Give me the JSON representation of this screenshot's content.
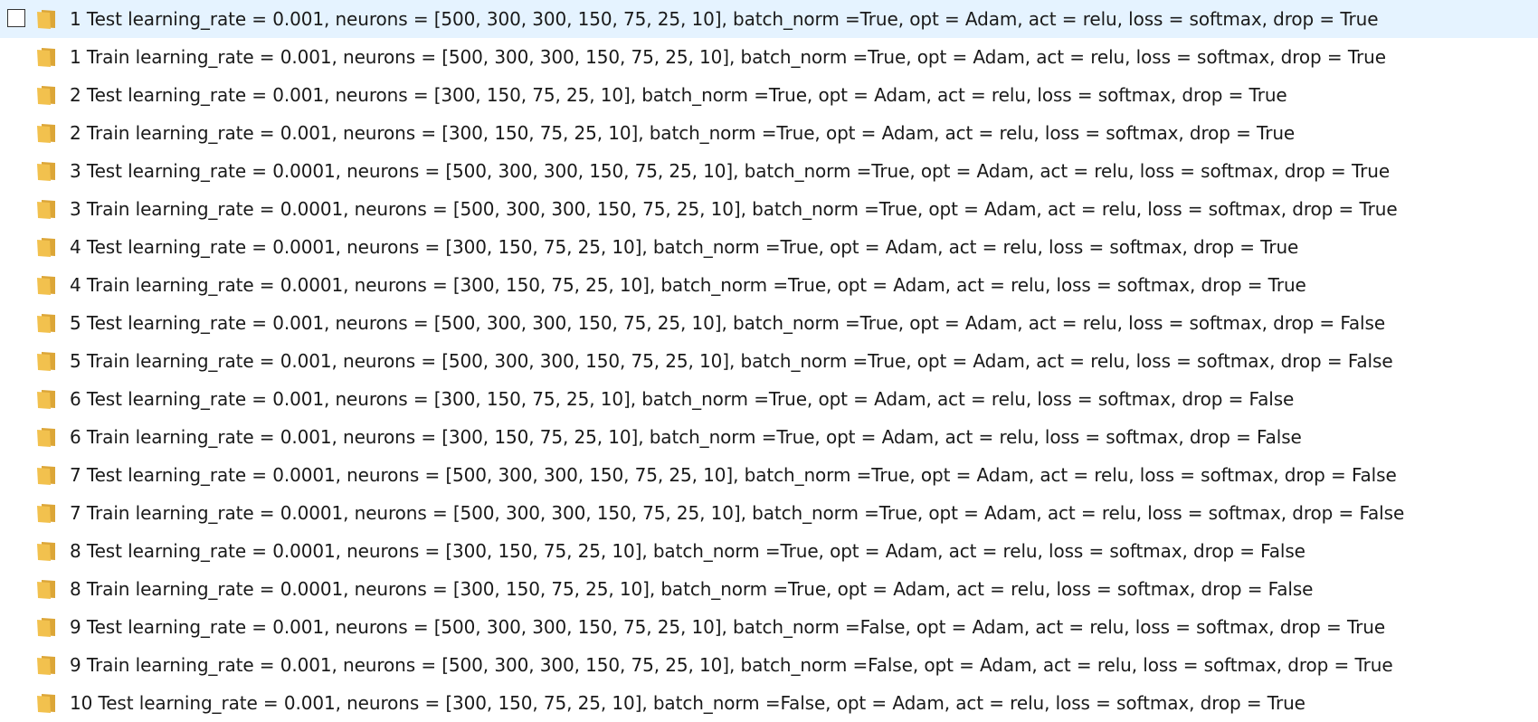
{
  "colors": {
    "selected_row_bg": "#e5f3ff",
    "folder_front": "#f2c14e",
    "folder_back": "#dca637"
  },
  "icon": "folder-icon",
  "items": [
    {
      "name": "1 Test learning_rate = 0.001, neurons = [500, 300, 300, 150, 75, 25, 10], batch_norm =True, opt = Adam, act = relu, loss = softmax, drop = True",
      "selected": true
    },
    {
      "name": "1 Train learning_rate = 0.001, neurons = [500, 300, 300, 150, 75, 25, 10], batch_norm =True, opt = Adam, act = relu, loss = softmax, drop = True"
    },
    {
      "name": "2 Test learning_rate = 0.001, neurons = [300, 150, 75, 25, 10], batch_norm =True, opt = Adam, act = relu, loss = softmax, drop = True"
    },
    {
      "name": "2 Train learning_rate = 0.001, neurons = [300, 150, 75, 25, 10], batch_norm =True, opt = Adam, act = relu, loss = softmax, drop = True"
    },
    {
      "name": "3 Test learning_rate = 0.0001, neurons = [500, 300, 300, 150, 75, 25, 10], batch_norm =True, opt = Adam, act = relu, loss = softmax, drop = True"
    },
    {
      "name": "3 Train learning_rate = 0.0001, neurons = [500, 300, 300, 150, 75, 25, 10], batch_norm =True, opt = Adam, act = relu, loss = softmax, drop = True"
    },
    {
      "name": "4 Test learning_rate = 0.0001, neurons = [300, 150, 75, 25, 10], batch_norm =True, opt = Adam, act = relu, loss = softmax, drop = True"
    },
    {
      "name": "4 Train learning_rate = 0.0001, neurons = [300, 150, 75, 25, 10], batch_norm =True, opt = Adam, act = relu, loss = softmax, drop = True"
    },
    {
      "name": "5 Test learning_rate = 0.001, neurons = [500, 300, 300, 150, 75, 25, 10], batch_norm =True, opt = Adam, act = relu, loss = softmax, drop = False"
    },
    {
      "name": "5 Train learning_rate = 0.001, neurons = [500, 300, 300, 150, 75, 25, 10], batch_norm =True, opt = Adam, act = relu, loss = softmax, drop = False"
    },
    {
      "name": "6 Test learning_rate = 0.001, neurons = [300, 150, 75, 25, 10], batch_norm =True, opt = Adam, act = relu, loss = softmax, drop = False"
    },
    {
      "name": "6 Train learning_rate = 0.001, neurons = [300, 150, 75, 25, 10], batch_norm =True, opt = Adam, act = relu, loss = softmax, drop = False"
    },
    {
      "name": "7 Test learning_rate = 0.0001, neurons = [500, 300, 300, 150, 75, 25, 10], batch_norm =True, opt = Adam, act = relu, loss = softmax, drop = False"
    },
    {
      "name": "7 Train learning_rate = 0.0001, neurons = [500, 300, 300, 150, 75, 25, 10], batch_norm =True, opt = Adam, act = relu, loss = softmax, drop = False"
    },
    {
      "name": "8 Test learning_rate = 0.0001, neurons = [300, 150, 75, 25, 10], batch_norm =True, opt = Adam, act = relu, loss = softmax, drop = False"
    },
    {
      "name": "8 Train learning_rate = 0.0001, neurons = [300, 150, 75, 25, 10], batch_norm =True, opt = Adam, act = relu, loss = softmax, drop = False"
    },
    {
      "name": "9 Test learning_rate = 0.001, neurons = [500, 300, 300, 150, 75, 25, 10], batch_norm =False, opt = Adam, act = relu, loss = softmax, drop = True"
    },
    {
      "name": "9 Train learning_rate = 0.001, neurons = [500, 300, 300, 150, 75, 25, 10], batch_norm =False, opt = Adam, act = relu, loss = softmax, drop = True"
    },
    {
      "name": "10 Test learning_rate = 0.001, neurons = [300, 150, 75, 25, 10], batch_norm =False, opt = Adam, act = relu, loss = softmax, drop = True"
    }
  ]
}
